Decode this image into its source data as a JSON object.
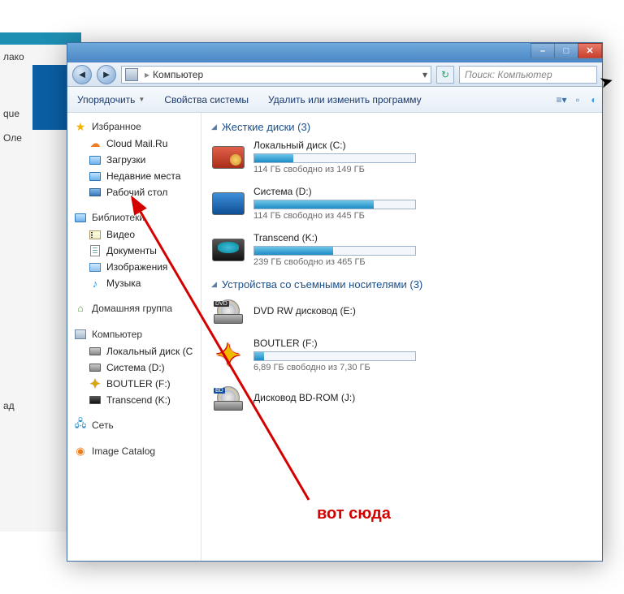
{
  "background": {
    "partial_text_1": "лако",
    "partial_text_2": "que",
    "partial_text_3": "Оле",
    "partial_text_4": "ад"
  },
  "window": {
    "address": {
      "location": "Компьютер",
      "dropdown": "▾"
    },
    "search_placeholder": "Поиск: Компьютер",
    "toolbar": {
      "organize": "Упорядочить",
      "system_props": "Свойства системы",
      "uninstall": "Удалить или изменить программу"
    }
  },
  "nav": {
    "favorites": {
      "label": "Избранное",
      "items": [
        "Cloud Mail.Ru",
        "Загрузки",
        "Недавние места",
        "Рабочий стол"
      ]
    },
    "libraries": {
      "label": "Библиотеки",
      "items": [
        "Видео",
        "Документы",
        "Изображения",
        "Музыка"
      ]
    },
    "homegroup": {
      "label": "Домашняя группа"
    },
    "computer": {
      "label": "Компьютер",
      "items": [
        "Локальный диск (C",
        "Система (D:)",
        "BOUTLER (F:)",
        "Transcend (K:)"
      ]
    },
    "network": {
      "label": "Сеть"
    },
    "imagecatalog": {
      "label": "Image Catalog"
    }
  },
  "sections": {
    "hdd": {
      "title": "Жесткие диски (3)",
      "drives": [
        {
          "name": "Локальный диск (C:)",
          "free": "114 ГБ свободно из 149 ГБ",
          "fill": 24
        },
        {
          "name": "Система (D:)",
          "free": "114 ГБ свободно из 445 ГБ",
          "fill": 74
        },
        {
          "name": "Transcend (K:)",
          "free": "239 ГБ свободно из 465 ГБ",
          "fill": 49
        }
      ]
    },
    "removable": {
      "title": "Устройства со съемными носителями (3)",
      "drives": [
        {
          "name": "DVD RW дисковод (E:)"
        },
        {
          "name": "BOUTLER (F:)",
          "free": "6,89 ГБ свободно из 7,30 ГБ",
          "fill": 6
        },
        {
          "name": "Дисковод BD-ROM (J:)"
        }
      ]
    }
  },
  "annotation": "вот сюда"
}
